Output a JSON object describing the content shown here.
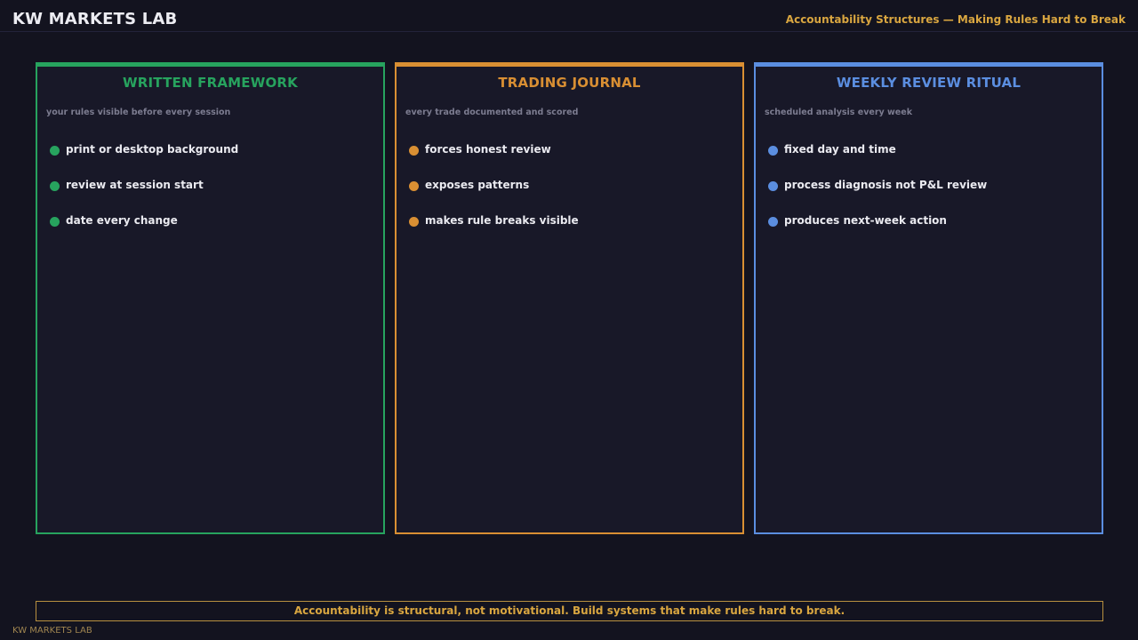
{
  "header": {
    "brand": "KW MARKETS LAB",
    "title": "Accountability Structures — Making Rules Hard to Break"
  },
  "colors": {
    "background": "#13131f",
    "card_background": "#181828",
    "green": "#27a35e",
    "orange": "#d98f33",
    "blue": "#5b8ee0",
    "gold": "#d9a640"
  },
  "cards": [
    {
      "title": "WRITTEN FRAMEWORK",
      "subtitle": "your rules visible before every session",
      "items": [
        "print or desktop background",
        "review at session start",
        "date every change"
      ]
    },
    {
      "title": "TRADING JOURNAL",
      "subtitle": "every trade documented and scored",
      "items": [
        "forces honest review",
        "exposes patterns",
        "makes rule breaks visible"
      ]
    },
    {
      "title": "WEEKLY REVIEW RITUAL",
      "subtitle": "scheduled analysis every week",
      "items": [
        "fixed day and time",
        "process diagnosis not P&L review",
        "produces next-week action"
      ]
    }
  ],
  "footer": {
    "banner": "Accountability is structural, not motivational. Build systems that make rules hard to break.",
    "brand": "KW MARKETS LAB"
  }
}
